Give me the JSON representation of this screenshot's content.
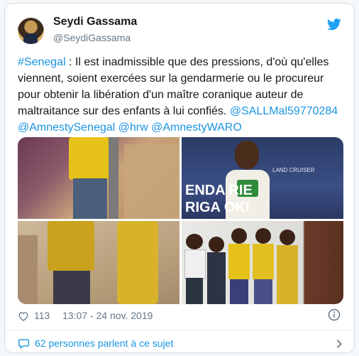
{
  "author": {
    "name": "Seydi Gassama",
    "handle": "@SeydiGassama"
  },
  "tweet": {
    "hashtag": "#Senegal",
    "body": " : Il est inadmissible que des pressions, d'où qu'elles viennent, soient exercées sur la gendarmerie ou le procureur pour obtenir la libération d'un maître coranique auteur de maltraitance sur des enfants à lui confiés. ",
    "mentions": [
      "@SALLMal59770284",
      "@AmnestySenegal",
      "@hrw",
      "@AmnestyWARO"
    ]
  },
  "media": {
    "vehicle_text_1": "ENDA  RIE",
    "vehicle_text_2": "RIGA   OKI",
    "vehicle_badge": "LAND CRUISER"
  },
  "footer": {
    "likes": "113",
    "timestamp": "13:07 - 24 nov. 2019",
    "conversation": "62 personnes parlent à ce sujet"
  },
  "colors": {
    "accent": "#1b95e0",
    "secondary": "#657786",
    "text": "#14171a"
  },
  "icons": {
    "brand": "twitter-bird-icon",
    "like": "heart-icon",
    "info": "info-icon",
    "talk": "speech-bubble-icon",
    "chevron": "chevron-right-icon"
  }
}
